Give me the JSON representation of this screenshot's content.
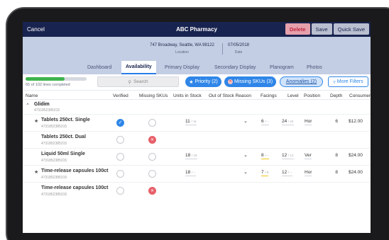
{
  "header": {
    "cancel": "Cancel",
    "title": "ABC Pharmacy",
    "delete": "Delete",
    "save": "Save",
    "quick_save": "Quick Save"
  },
  "info": {
    "address": "747 Broadway, Seattle, WA 98122",
    "address_label": "Location",
    "date": "07/05/2018",
    "date_label": "Date"
  },
  "tabs": [
    "Dashboard",
    "Availability",
    "Primary Display",
    "Secondary Display",
    "Planogram",
    "Photos"
  ],
  "active_tab": "Availability",
  "progress": {
    "label": "65 of 102 lines completed",
    "fraction": 0.637
  },
  "search": {
    "placeholder": "Search"
  },
  "filters": {
    "priority": "Priority (2)",
    "missing": "Missing SKUs (3)",
    "anomalies": "Anomalies (2)",
    "more": "More Filters"
  },
  "columns": [
    "Name",
    "Verified",
    "Missing SKUs",
    "Units in Stock",
    "Out of Stock Reason",
    "Facings",
    "Level",
    "Position",
    "Depth",
    "Consumer"
  ],
  "group": {
    "name": "Glidim",
    "sku": "4731852385315"
  },
  "rows": [
    {
      "starred": true,
      "name": "Tablets 250ct. Single",
      "sku": "4731852385315",
      "verified": true,
      "missing": false,
      "units": "11",
      "units_prev": "/ 11",
      "has_reason": true,
      "facings": "6",
      "facings_prev": "/ --",
      "level": "24",
      "level_prev": "/ 24",
      "position": "Hor",
      "depth": "6",
      "price": "$12.00"
    },
    {
      "starred": false,
      "name": "Tablets 250ct. Dual",
      "sku": "4731852385315",
      "verified": false,
      "missing": true
    },
    {
      "starred": false,
      "name": "Liquid 50ml Single",
      "sku": "4731852385315",
      "verified": false,
      "missing": false,
      "units": "18",
      "units_prev": "/ 18",
      "has_reason": true,
      "facings": "8",
      "facings_prev": "/ --",
      "level": "12",
      "level_prev": "/ 12",
      "position": "Ver",
      "depth": "8",
      "price": "$24.00"
    },
    {
      "starred": true,
      "name": "Time-release capsules 100ct",
      "sku": "4731852385315",
      "verified": false,
      "missing": false,
      "units": "18",
      "units_prev": "/ --",
      "has_reason": true,
      "facings": "7",
      "facings_prev": "/ 8",
      "level": "12",
      "level_prev": "/ --",
      "position": "Hor",
      "depth": "8",
      "price": "$24.00"
    },
    {
      "starred": false,
      "name": "Time-release capsules 100ct",
      "sku": "4731852385315",
      "verified": false,
      "missing": true
    }
  ],
  "colors": {
    "navy": "#18234f",
    "accent": "#2f86e8",
    "progress": "#3fb34f",
    "delete": "#c0253e"
  }
}
